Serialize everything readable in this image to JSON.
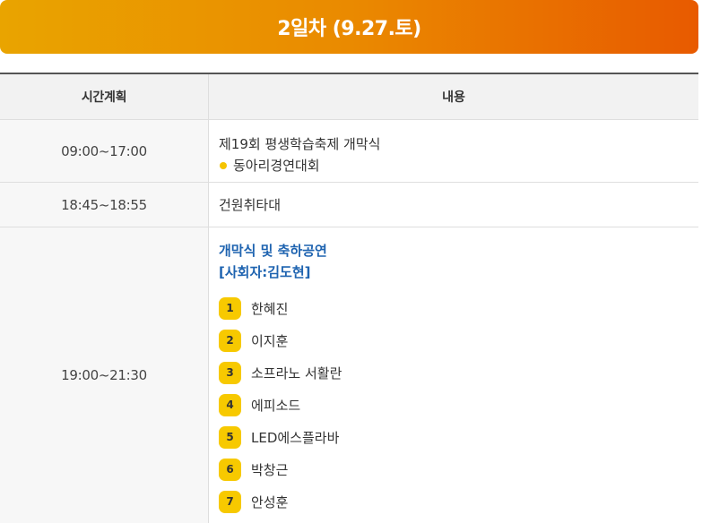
{
  "banner": {
    "title": "2일차 (9.27.토)"
  },
  "table": {
    "headers": {
      "time": "시간계획",
      "content": "내용"
    },
    "rows": [
      {
        "time": "09:00~17:00",
        "title": "제19회 평생학습축제 개막식",
        "bullet": "동아리경연대회"
      },
      {
        "time": "18:45~18:55",
        "title": "건원취타대"
      },
      {
        "time": "19:00~21:30",
        "heading": "개막식 및 축하공연",
        "subheading": "[사회자:김도현]",
        "items": [
          {
            "num": "1",
            "label": "한혜진"
          },
          {
            "num": "2",
            "label": "이지훈"
          },
          {
            "num": "3",
            "label": "소프라노 서활란"
          },
          {
            "num": "4",
            "label": "에피소드"
          },
          {
            "num": "5",
            "label": "LED에스플라바"
          },
          {
            "num": "6",
            "label": "박창근"
          },
          {
            "num": "7",
            "label": "안성훈"
          }
        ]
      }
    ]
  }
}
